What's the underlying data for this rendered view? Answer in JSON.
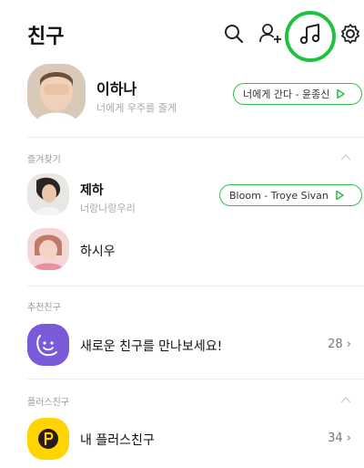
{
  "header": {
    "title": "친구",
    "icons": [
      "search-icon",
      "add-friend-icon",
      "music-icon",
      "settings-icon"
    ],
    "highlight_color": "#1fc23f"
  },
  "profile": {
    "name": "이하나",
    "status": "너에게 우주를 줄게",
    "music": "너에게 간다 - 윤종신"
  },
  "favorites": {
    "label": "즐겨찾기",
    "items": [
      {
        "name": "제하",
        "status": "너랑나랑우리",
        "music": "Bloom - Troye Sivan"
      },
      {
        "name": "하시우",
        "status": "",
        "music": ""
      }
    ]
  },
  "recommended": {
    "label": "추천친구",
    "item_label": "새로운 친구를 만나보세요!",
    "count": "28"
  },
  "plus": {
    "label": "플러스친구",
    "item_label": "내 플러스친구",
    "count": "34"
  },
  "colors": {
    "accent_green": "#2ec14a",
    "recommend_purple": "#7a5ad8",
    "plus_yellow": "#ffd400"
  }
}
